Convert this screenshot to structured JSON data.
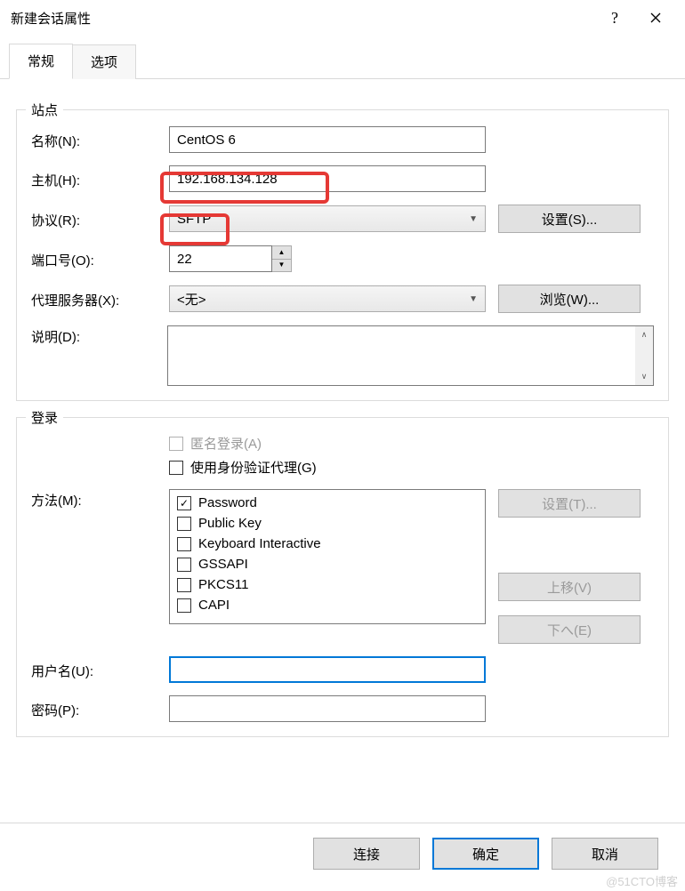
{
  "title": "新建会话属性",
  "tabs": {
    "general": "常规",
    "options": "选项"
  },
  "group_site": "站点",
  "group_login": "登录",
  "labels": {
    "name": "名称(N):",
    "host": "主机(H):",
    "protocol": "协议(R):",
    "port": "端口号(O):",
    "proxy": "代理服务器(X):",
    "desc": "说明(D):",
    "method": "方法(M):",
    "username": "用户名(U):",
    "password": "密码(P):"
  },
  "values": {
    "name": "CentOS 6",
    "host": "192.168.134.128",
    "protocol": "SFTP",
    "port": "22",
    "proxy": "<无>"
  },
  "buttons": {
    "settings_s": "设置(S)...",
    "browse_w": "浏览(W)...",
    "settings_t": "设置(T)...",
    "moveup": "上移(V)",
    "movedown": "下へ(E)",
    "connect": "连接",
    "ok": "确定",
    "cancel": "取消"
  },
  "checkboxes": {
    "anonymous": "匿名登录(A)",
    "use_agent": "使用身份验证代理(G)"
  },
  "methods": [
    "Password",
    "Public Key",
    "Keyboard Interactive",
    "GSSAPI",
    "PKCS11",
    "CAPI"
  ],
  "methods_checked": [
    true,
    false,
    false,
    false,
    false,
    false
  ],
  "watermark": "@51CTO博客"
}
